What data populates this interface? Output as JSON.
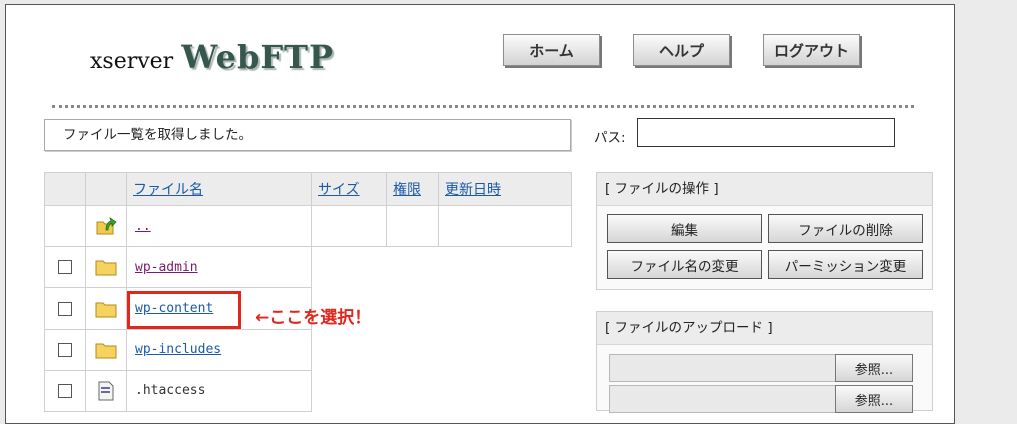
{
  "header": {
    "logo_prefix": "xserver",
    "logo_name": "WebFTP",
    "buttons": {
      "home": "ホーム",
      "help": "ヘルプ",
      "logout": "ログアウト"
    }
  },
  "status_message": "ファイル一覧を取得しました。",
  "path": {
    "label": "パス:",
    "value": ""
  },
  "file_table": {
    "columns": {
      "name": "ファイル名",
      "size": "サイズ",
      "perm": "権限",
      "modified": "更新日時"
    },
    "rows": [
      {
        "name": "..",
        "type": "parent-folder",
        "checkbox": false
      },
      {
        "name": "wp-admin",
        "type": "folder",
        "checkbox": true
      },
      {
        "name": "wp-content",
        "type": "folder",
        "checkbox": true
      },
      {
        "name": "wp-includes",
        "type": "folder",
        "checkbox": true
      },
      {
        "name": ".htaccess",
        "type": "file",
        "checkbox": true
      }
    ]
  },
  "annotation": "←ここを選択！",
  "annotation_color": "#e1261c",
  "file_ops": {
    "title": "[ ファイルの操作 ]",
    "edit": "編集",
    "delete": "ファイルの削除",
    "rename": "ファイル名の変更",
    "permission": "パーミッション変更"
  },
  "upload": {
    "title": "[ ファイルのアップロード ]",
    "browse_1": "参照...",
    "browse_2": "参照..."
  }
}
